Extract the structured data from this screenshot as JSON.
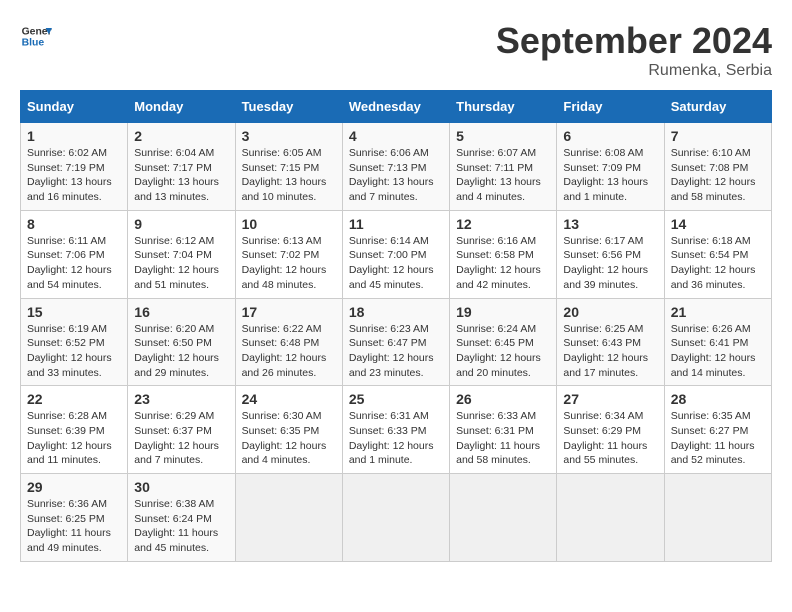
{
  "logo": {
    "text_general": "General",
    "text_blue": "Blue"
  },
  "title": "September 2024",
  "subtitle": "Rumenka, Serbia",
  "days_header": [
    "Sunday",
    "Monday",
    "Tuesday",
    "Wednesday",
    "Thursday",
    "Friday",
    "Saturday"
  ],
  "weeks": [
    [
      {
        "day": "1",
        "info": "Sunrise: 6:02 AM\nSunset: 7:19 PM\nDaylight: 13 hours\nand 16 minutes."
      },
      {
        "day": "2",
        "info": "Sunrise: 6:04 AM\nSunset: 7:17 PM\nDaylight: 13 hours\nand 13 minutes."
      },
      {
        "day": "3",
        "info": "Sunrise: 6:05 AM\nSunset: 7:15 PM\nDaylight: 13 hours\nand 10 minutes."
      },
      {
        "day": "4",
        "info": "Sunrise: 6:06 AM\nSunset: 7:13 PM\nDaylight: 13 hours\nand 7 minutes."
      },
      {
        "day": "5",
        "info": "Sunrise: 6:07 AM\nSunset: 7:11 PM\nDaylight: 13 hours\nand 4 minutes."
      },
      {
        "day": "6",
        "info": "Sunrise: 6:08 AM\nSunset: 7:09 PM\nDaylight: 13 hours\nand 1 minute."
      },
      {
        "day": "7",
        "info": "Sunrise: 6:10 AM\nSunset: 7:08 PM\nDaylight: 12 hours\nand 58 minutes."
      }
    ],
    [
      {
        "day": "8",
        "info": "Sunrise: 6:11 AM\nSunset: 7:06 PM\nDaylight: 12 hours\nand 54 minutes."
      },
      {
        "day": "9",
        "info": "Sunrise: 6:12 AM\nSunset: 7:04 PM\nDaylight: 12 hours\nand 51 minutes."
      },
      {
        "day": "10",
        "info": "Sunrise: 6:13 AM\nSunset: 7:02 PM\nDaylight: 12 hours\nand 48 minutes."
      },
      {
        "day": "11",
        "info": "Sunrise: 6:14 AM\nSunset: 7:00 PM\nDaylight: 12 hours\nand 45 minutes."
      },
      {
        "day": "12",
        "info": "Sunrise: 6:16 AM\nSunset: 6:58 PM\nDaylight: 12 hours\nand 42 minutes."
      },
      {
        "day": "13",
        "info": "Sunrise: 6:17 AM\nSunset: 6:56 PM\nDaylight: 12 hours\nand 39 minutes."
      },
      {
        "day": "14",
        "info": "Sunrise: 6:18 AM\nSunset: 6:54 PM\nDaylight: 12 hours\nand 36 minutes."
      }
    ],
    [
      {
        "day": "15",
        "info": "Sunrise: 6:19 AM\nSunset: 6:52 PM\nDaylight: 12 hours\nand 33 minutes."
      },
      {
        "day": "16",
        "info": "Sunrise: 6:20 AM\nSunset: 6:50 PM\nDaylight: 12 hours\nand 29 minutes."
      },
      {
        "day": "17",
        "info": "Sunrise: 6:22 AM\nSunset: 6:48 PM\nDaylight: 12 hours\nand 26 minutes."
      },
      {
        "day": "18",
        "info": "Sunrise: 6:23 AM\nSunset: 6:47 PM\nDaylight: 12 hours\nand 23 minutes."
      },
      {
        "day": "19",
        "info": "Sunrise: 6:24 AM\nSunset: 6:45 PM\nDaylight: 12 hours\nand 20 minutes."
      },
      {
        "day": "20",
        "info": "Sunrise: 6:25 AM\nSunset: 6:43 PM\nDaylight: 12 hours\nand 17 minutes."
      },
      {
        "day": "21",
        "info": "Sunrise: 6:26 AM\nSunset: 6:41 PM\nDaylight: 12 hours\nand 14 minutes."
      }
    ],
    [
      {
        "day": "22",
        "info": "Sunrise: 6:28 AM\nSunset: 6:39 PM\nDaylight: 12 hours\nand 11 minutes."
      },
      {
        "day": "23",
        "info": "Sunrise: 6:29 AM\nSunset: 6:37 PM\nDaylight: 12 hours\nand 7 minutes."
      },
      {
        "day": "24",
        "info": "Sunrise: 6:30 AM\nSunset: 6:35 PM\nDaylight: 12 hours\nand 4 minutes."
      },
      {
        "day": "25",
        "info": "Sunrise: 6:31 AM\nSunset: 6:33 PM\nDaylight: 12 hours\nand 1 minute."
      },
      {
        "day": "26",
        "info": "Sunrise: 6:33 AM\nSunset: 6:31 PM\nDaylight: 11 hours\nand 58 minutes."
      },
      {
        "day": "27",
        "info": "Sunrise: 6:34 AM\nSunset: 6:29 PM\nDaylight: 11 hours\nand 55 minutes."
      },
      {
        "day": "28",
        "info": "Sunrise: 6:35 AM\nSunset: 6:27 PM\nDaylight: 11 hours\nand 52 minutes."
      }
    ],
    [
      {
        "day": "29",
        "info": "Sunrise: 6:36 AM\nSunset: 6:25 PM\nDaylight: 11 hours\nand 49 minutes."
      },
      {
        "day": "30",
        "info": "Sunrise: 6:38 AM\nSunset: 6:24 PM\nDaylight: 11 hours\nand 45 minutes."
      },
      {
        "day": "",
        "info": ""
      },
      {
        "day": "",
        "info": ""
      },
      {
        "day": "",
        "info": ""
      },
      {
        "day": "",
        "info": ""
      },
      {
        "day": "",
        "info": ""
      }
    ]
  ]
}
